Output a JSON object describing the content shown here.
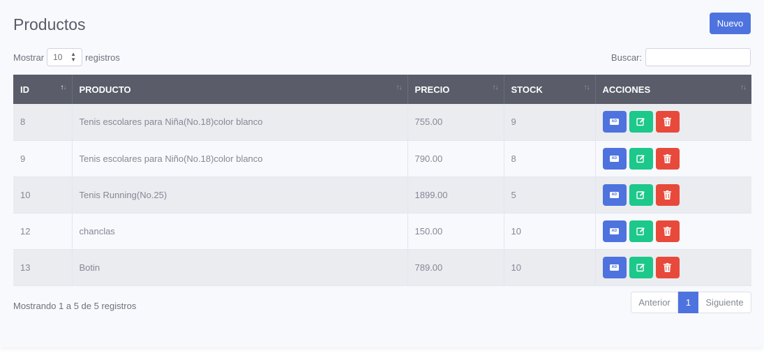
{
  "header": {
    "title": "Productos",
    "new_button": "Nuevo"
  },
  "length_control": {
    "prefix": "Mostrar",
    "value": "10",
    "suffix": "registros"
  },
  "search": {
    "label": "Buscar:",
    "value": ""
  },
  "table": {
    "columns": [
      "ID",
      "PRODUCTO",
      "PRECIO",
      "STOCK",
      "ACCIONES"
    ],
    "rows": [
      {
        "id": "8",
        "product": "Tenis escolares para Niña(No.18)color blanco",
        "price": "755.00",
        "stock": "9"
      },
      {
        "id": "9",
        "product": "Tenis escolares para Niño(No.18)color blanco",
        "price": "790.00",
        "stock": "8"
      },
      {
        "id": "10",
        "product": "Tenis Running(No.25)",
        "price": "1899.00",
        "stock": "5"
      },
      {
        "id": "12",
        "product": "chanclas",
        "price": "150.00",
        "stock": "10"
      },
      {
        "id": "13",
        "product": "Botin",
        "price": "789.00",
        "stock": "10"
      }
    ],
    "action_icons": [
      "id-card-icon",
      "edit-icon",
      "trash-icon"
    ],
    "view_icon_text": "AD"
  },
  "footer": {
    "info": "Mostrando 1 a 5 de 5 registros",
    "prev": "Anterior",
    "current_page": "1",
    "next": "Siguiente"
  },
  "colors": {
    "primary": "#4e73df",
    "success": "#1cc88a",
    "danger": "#e74a3b",
    "header_bg": "#5a5c69"
  }
}
